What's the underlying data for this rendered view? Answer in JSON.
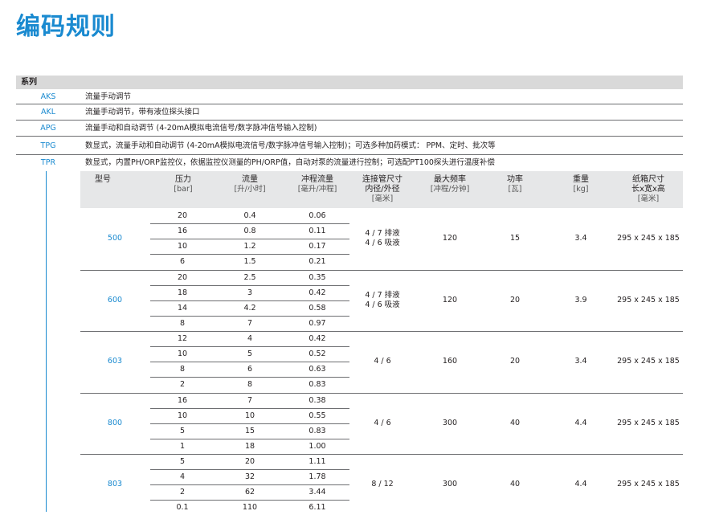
{
  "title": "编码规则",
  "series_header": "系列",
  "series": [
    {
      "code": "AKS",
      "desc": "流量手动调节"
    },
    {
      "code": "AKL",
      "desc": "流量手动调节，带有液位探头接口"
    },
    {
      "code": "APG",
      "desc": "流量手动和自动调节 (4-20mA模拟电流信号/数字脉冲信号输入控制)"
    },
    {
      "code": "TPG",
      "desc": "数显式，流量手动和自动调节 (4-20mA模拟电流信号/数字脉冲信号输入控制)；可选多种加药模式： PPM、定时、批次等"
    },
    {
      "code": "TPR",
      "desc": "数显式，内置PH/ORP监控仪，依据监控仪测量的PH/ORP值，自动对泵的流量进行控制；可选配PT100探头进行温度补偿"
    }
  ],
  "headers": {
    "model": "型号",
    "pressure": [
      "压力",
      "[bar]"
    ],
    "flow": [
      "流量",
      "[升/小时]"
    ],
    "stroke": [
      "冲程流量",
      "[毫升/冲程]"
    ],
    "pipe": [
      "连接管尺寸",
      "内径/外径",
      "[毫米]"
    ],
    "freq": [
      "最大频率",
      "[冲程/分钟]"
    ],
    "power": [
      "功率",
      "[瓦]"
    ],
    "weight": [
      "重量",
      "[kg]"
    ],
    "box": [
      "纸箱尺寸",
      "长x宽x高",
      "[毫米]"
    ]
  },
  "models": [
    {
      "model": "500",
      "pipe": [
        "4 / 7 排液",
        "4 / 6 吸液"
      ],
      "freq": "120",
      "power": "15",
      "weight": "3.4",
      "box": "295 x 245 x 185",
      "rows": [
        [
          "20",
          "0.4",
          "0.06"
        ],
        [
          "16",
          "0.8",
          "0.11"
        ],
        [
          "10",
          "1.2",
          "0.17"
        ],
        [
          "6",
          "1.5",
          "0.21"
        ]
      ]
    },
    {
      "model": "600",
      "pipe": [
        "4 / 7 排液",
        "4 / 6 吸液"
      ],
      "freq": "120",
      "power": "20",
      "weight": "3.9",
      "box": "295 x 245 x 185",
      "rows": [
        [
          "20",
          "2.5",
          "0.35"
        ],
        [
          "18",
          "3",
          "0.42"
        ],
        [
          "14",
          "4.2",
          "0.58"
        ],
        [
          "8",
          "7",
          "0.97"
        ]
      ]
    },
    {
      "model": "603",
      "pipe": [
        "4 / 6"
      ],
      "freq": "160",
      "power": "20",
      "weight": "3.4",
      "box": "295 x 245 x 185",
      "rows": [
        [
          "12",
          "4",
          "0.42"
        ],
        [
          "10",
          "5",
          "0.52"
        ],
        [
          "8",
          "6",
          "0.63"
        ],
        [
          "2",
          "8",
          "0.83"
        ]
      ]
    },
    {
      "model": "800",
      "pipe": [
        "4 / 6"
      ],
      "freq": "300",
      "power": "40",
      "weight": "4.4",
      "box": "295 x 245 x 185",
      "rows": [
        [
          "16",
          "7",
          "0.38"
        ],
        [
          "10",
          "10",
          "0.55"
        ],
        [
          "5",
          "15",
          "0.83"
        ],
        [
          "1",
          "18",
          "1.00"
        ]
      ]
    },
    {
      "model": "803",
      "pipe": [
        "8 / 12"
      ],
      "freq": "300",
      "power": "40",
      "weight": "4.4",
      "box": "295 x 245 x 185",
      "rows": [
        [
          "5",
          "20",
          "1.11"
        ],
        [
          "4",
          "32",
          "1.78"
        ],
        [
          "2",
          "62",
          "3.44"
        ],
        [
          "0.1",
          "110",
          "6.11"
        ]
      ]
    }
  ]
}
